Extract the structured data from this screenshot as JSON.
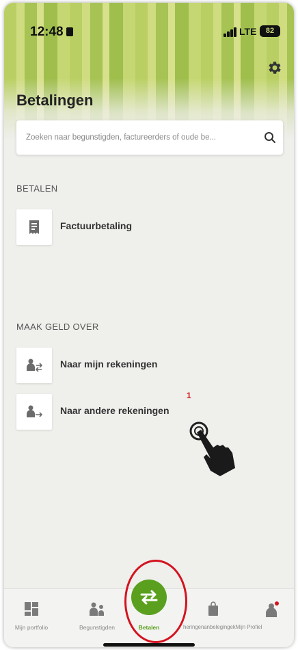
{
  "status_bar": {
    "time": "12:48",
    "network": "LTE",
    "battery": "82"
  },
  "header": {
    "title": "Betalingen",
    "settings_icon": "gear-icon"
  },
  "search": {
    "placeholder": "Zoeken naar begunstigden, factureerders of oude be...Q",
    "placeholder_text": "Zoeken naar begunstigden, factureerders of oude be...",
    "icon": "search-icon"
  },
  "sections": {
    "betalen": {
      "label": "BETALEN",
      "items": [
        {
          "label": "Factuurbetaling",
          "icon": "invoice-icon"
        }
      ]
    },
    "transfer": {
      "label": "MAAK GELD OVER",
      "items": [
        {
          "label": "Naar mijn rekeningen",
          "icon": "transfer-own-icon"
        },
        {
          "label": "Naar andere rekeningen",
          "icon": "transfer-other-icon"
        }
      ]
    }
  },
  "annotation": {
    "step_number": "1"
  },
  "bottom_nav": {
    "items": [
      {
        "label": "Mijn portfolio",
        "icon": "portfolio-icon"
      },
      {
        "label": "Begunstigden",
        "icon": "payees-icon"
      },
      {
        "label": "Betalen",
        "icon": "transfer-arrows-icon",
        "active": true
      },
      {
        "label": "Beleggingen",
        "icon": "bag-icon"
      },
      {
        "label": "Mijn Profiel",
        "icon": "profile-icon"
      }
    ],
    "overlap_text": "heringenanbelegingekMijn Profiel"
  },
  "colors": {
    "accent": "#5aa01e",
    "highlight": "#d3131f",
    "background": "#efefec"
  }
}
